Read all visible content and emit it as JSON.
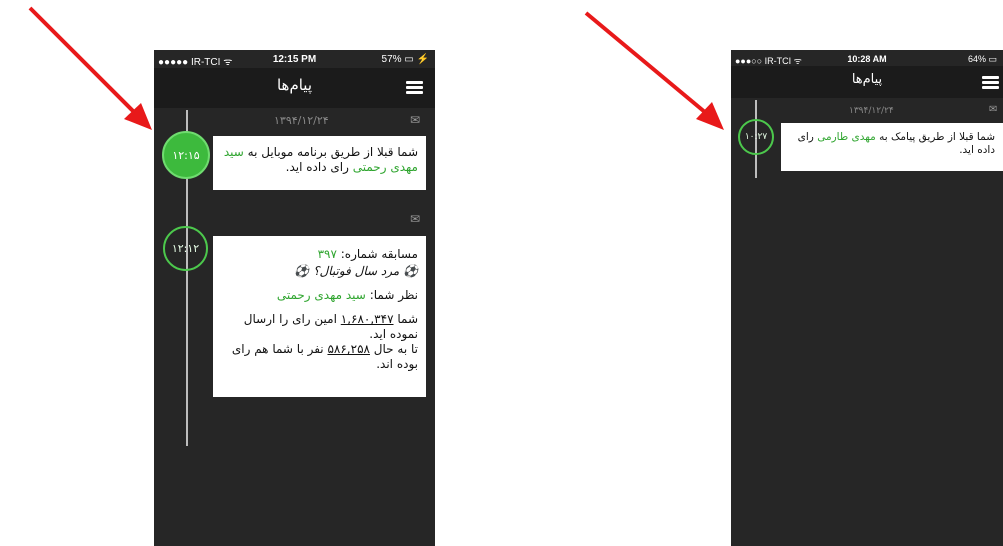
{
  "colors": {
    "accent_green": "#3dba3d",
    "arrow_red": "#e8191a",
    "app_bg": "#262626",
    "navbar_bg": "#1b1b1b"
  },
  "phone1": {
    "status": {
      "carrier": "●●●●● IR-TCI ᯤ",
      "time": "12:15 PM",
      "battery": "57% ▭ ⚡"
    },
    "title": "پیام‌ها",
    "messages": [
      {
        "date": "۱۳۹۴/۱۲/۲۴",
        "time": "۱۲:۱۵",
        "icon": "envelope-icon",
        "text_before": "شما قبلا از طریق برنامه موبایل به",
        "name": "سید مهدی رحمتی",
        "text_after": "رای داده اید."
      },
      {
        "time": "۱۲:۱۲",
        "icon": "envelope-open-icon",
        "contest_label": "مسابقه شماره:",
        "contest_number": "۳۹۷",
        "question": "⚽ مرد سال فوتبال؟ ⚽",
        "opinion_label": "نظر شما:",
        "opinion_name": "سید مهدی رحمتی",
        "rank_prefix": "شما",
        "rank_number": "۱,۶۸۰,۳۴۷",
        "rank_suffix": "امین رای را ارسال نموده اید.",
        "agree_prefix": "تا به حال",
        "agree_number": "۵۸۶,۲۵۸",
        "agree_suffix": "نفر با شما هم رای بوده اند."
      }
    ]
  },
  "phone2": {
    "status": {
      "carrier": "●●●○○ IR-TCI ᯤ",
      "time": "10:28 AM",
      "battery": "64% ▭"
    },
    "title": "پیام‌ها",
    "messages": [
      {
        "date": "۱۳۹۴/۱۲/۲۴",
        "time": "۱۰:۲۷",
        "icon": "envelope-open-icon",
        "text_before": "شما قبلا از طریق پیامک به",
        "name": "مهدی طارمی",
        "text_after": "رای داده اید."
      }
    ]
  }
}
